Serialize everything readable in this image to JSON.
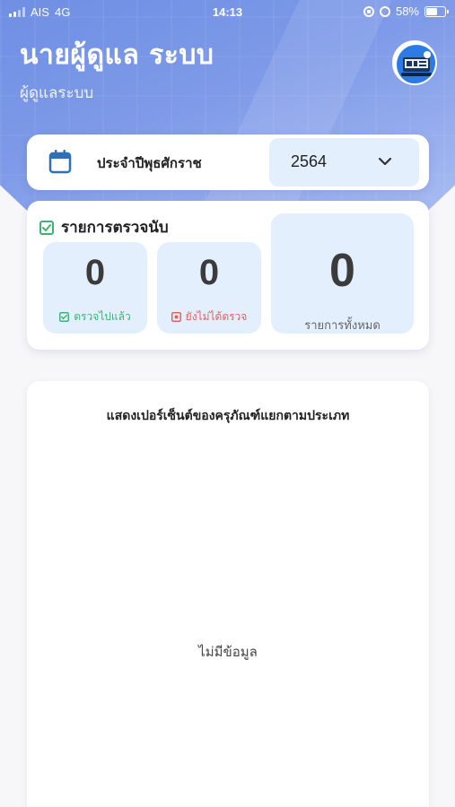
{
  "status_bar": {
    "carrier": "AIS",
    "network": "4G",
    "time": "14:13",
    "battery": "58%",
    "battery_level": 0.58
  },
  "header": {
    "title": "นายผู้ดูแล ระบบ",
    "subtitle": "ผู้ดูแลระบบ",
    "avatar_icon": "avatar-image"
  },
  "year_selector": {
    "label": "ประจำปีพุธศักราช",
    "value": "2564",
    "icon": "calendar-icon"
  },
  "inventory_count": {
    "title": "รายการตรวจนับ",
    "checked": {
      "value": "0",
      "label": "ตรวจไปแล้ว"
    },
    "unchecked": {
      "value": "0",
      "label": "ยังไม่ได้ตรวจ"
    },
    "total": {
      "value": "0",
      "label": "รายการทั้งหมด"
    }
  },
  "chart": {
    "title": "แสดงเปอร์เซ็นต์ของครุภัณฑ์แยกตามประเภท",
    "empty_text": "ไม่มีข้อมูล"
  },
  "colors": {
    "header_blue": "#7e9ae8",
    "stat_bg": "#e3effd",
    "checked_green": "#3cb371",
    "unchecked_red": "#e06060",
    "calendar_blue": "#2f6fb6"
  }
}
